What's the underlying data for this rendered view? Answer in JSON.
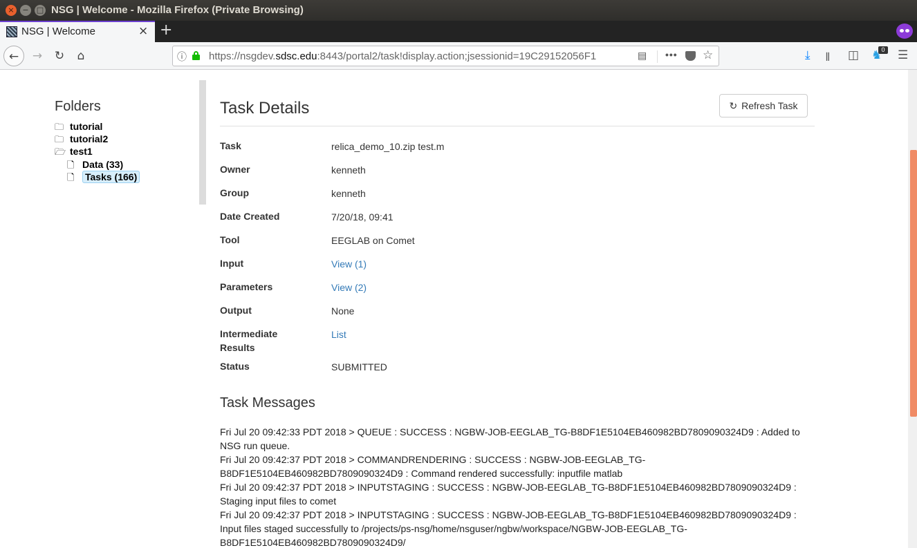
{
  "window": {
    "title": "NSG | Welcome - Mozilla Firefox (Private Browsing)",
    "close_glyph": "×",
    "min_glyph": "−",
    "max_glyph": "□"
  },
  "tabs": [
    {
      "title": "NSG | Welcome",
      "close_glyph": "×",
      "active": true
    }
  ],
  "tabstrip": {
    "new_tab_glyph": "+"
  },
  "nav": {
    "back_glyph": "←",
    "forward_glyph": "→",
    "reload_glyph": "↻",
    "home_glyph": "⌂",
    "info_glyph": "ⓘ",
    "url_prefix": "https://nsgdev.",
    "url_domain": "sdsc.edu",
    "url_suffix": ":8443/portal2/task!display.action;jsessionid=19C29152056F1",
    "reader_glyph": "▤",
    "more_glyph": "•••",
    "star_glyph": "☆",
    "download_glyph": "⤓",
    "library_glyph": "𝍪",
    "sidebar_glyph": "◫",
    "ghost_glyph": "♞",
    "badge_count": "0",
    "menu_glyph": "☰"
  },
  "sidebar": {
    "title": "Folders",
    "folder_icon": "🗀",
    "open_folder_icon": "🗁",
    "file_icon": "🗋",
    "items": [
      {
        "label": "tutorial"
      },
      {
        "label": "tutorial2"
      },
      {
        "label": "test1"
      },
      {
        "label": "Data (33)"
      },
      {
        "label": "Tasks (166)"
      }
    ]
  },
  "task_details": {
    "title": "Task Details",
    "refresh_label": "Refresh Task",
    "refresh_glyph": "↻",
    "rows": [
      {
        "label": "Task",
        "value": "relica_demo_10.zip test.m"
      },
      {
        "label": "Owner",
        "value": "kenneth"
      },
      {
        "label": "Group",
        "value": "kenneth"
      },
      {
        "label": "Date Created",
        "value": "7/20/18, 09:41"
      },
      {
        "label": "Tool",
        "value": "EEGLAB on Comet"
      },
      {
        "label": "Input",
        "value": "View (1)"
      },
      {
        "label": "Parameters",
        "value": "View (2)"
      },
      {
        "label": "Output",
        "value": "None"
      },
      {
        "label": "Intermediate Results",
        "value": "List"
      },
      {
        "label": "Status",
        "value": "SUBMITTED"
      }
    ]
  },
  "task_messages": {
    "title": "Task Messages",
    "lines": [
      "Fri Jul 20 09:42:33 PDT 2018 > QUEUE : SUCCESS : NGBW-JOB-EEGLAB_TG-B8DF1E5104EB460982BD7809090324D9 : Added to NSG run queue.",
      "Fri Jul 20 09:42:37 PDT 2018 > COMMANDRENDERING : SUCCESS : NGBW-JOB-EEGLAB_TG-B8DF1E5104EB460982BD7809090324D9 : Command rendered successfully: inputfile matlab",
      "Fri Jul 20 09:42:37 PDT 2018 > INPUTSTAGING : SUCCESS : NGBW-JOB-EEGLAB_TG-B8DF1E5104EB460982BD7809090324D9 : Staging input files to comet",
      "Fri Jul 20 09:42:37 PDT 2018 > INPUTSTAGING : SUCCESS : NGBW-JOB-EEGLAB_TG-B8DF1E5104EB460982BD7809090324D9 : Input files staged successfully to /projects/ps-nsg/home/nsguser/ngbw/workspace/NGBW-JOB-EEGLAB_TG-B8DF1E5104EB460982BD7809090324D9/"
    ]
  },
  "colors": {
    "link": "#337ab7",
    "accent": "#8c3bd8",
    "scroll_thumb": "#f08b65"
  }
}
